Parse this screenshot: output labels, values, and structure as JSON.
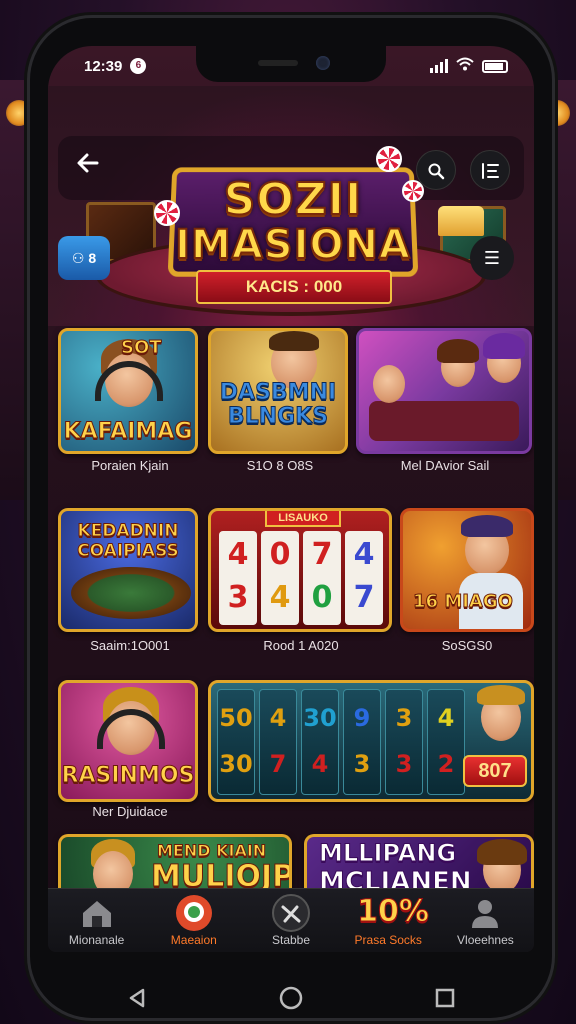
{
  "status_bar": {
    "time": "12:39",
    "notif_badge": "6"
  },
  "hero": {
    "title_line1": "SOZII",
    "title_line2": "IMASIONA",
    "ribbon": "KACIS : 000",
    "side_badge": "⚇ 8",
    "side_menu": "☰"
  },
  "games_row1": [
    {
      "title": "KAFAIMAG",
      "art_text": "SOT",
      "label": "Poraien Kjain",
      "bg": "#2a6a8a"
    },
    {
      "title": "DASBMNI BLNGKS",
      "label": "S1O 8 O8S",
      "bg": "#c89a30"
    },
    {
      "title": "",
      "label": "Mel DAvior Sail",
      "bg": "#7a3aa0"
    }
  ],
  "games_row2": [
    {
      "title": "KEDADNIN COAIPIASS",
      "label": "Saaim:1O001",
      "bg": "#2a3a8a"
    },
    {
      "reels_top": [
        "4",
        "0",
        "7",
        "4"
      ],
      "reels_bottom": [
        "3",
        "4",
        "0",
        "7"
      ],
      "header": "LISAUKO",
      "label": "Rood 1 A020",
      "bg": "#8a1a1a"
    },
    {
      "title": "16 MIAGO",
      "label": "SoSGS0",
      "bg": "#c8481a"
    }
  ],
  "games_row3": [
    {
      "title": "RASINMOS",
      "label": "Ner Djuidace",
      "bg": "#b02a6a"
    },
    {
      "reels_top": [
        "50",
        "4",
        "30",
        "9",
        "3",
        "4"
      ],
      "reels_bottom": [
        "30",
        "7",
        "4",
        "3",
        "3",
        "2"
      ],
      "jackpot": "807",
      "bg": "#1a3a4a"
    }
  ],
  "games_row4": [
    {
      "title_line1": "MEND KIAIN",
      "title_line2": "MULIOJP",
      "bg": "#2a6a3a"
    },
    {
      "title_line1": "MLLIPANG",
      "title_line2": "MCLIANEN",
      "badge": "10%",
      "bg": "#3a1a5a"
    }
  ],
  "bottom_nav": [
    {
      "label": "Mionanale",
      "icon": "home-icon"
    },
    {
      "label": "Maeaion",
      "icon": "chat-icon",
      "active": true
    },
    {
      "label": "Stabbe",
      "icon": "slash-icon"
    },
    {
      "label": "Prasa Socks",
      "icon": "tag-icon",
      "active": true
    },
    {
      "label": "Vloeehnes",
      "icon": "profile-icon"
    }
  ],
  "colors": {
    "accent_gold": "#e0a62a",
    "accent_orange": "#ff7a2a",
    "chip_red": "#e02040"
  }
}
